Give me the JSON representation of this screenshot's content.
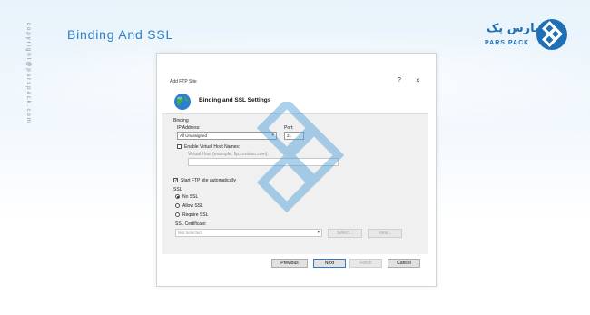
{
  "page": {
    "title": "Binding And SSL",
    "side_text": "copyright@parspack.com"
  },
  "logo": {
    "persian": "پارس پک",
    "english": "PARS PACK",
    "colors": {
      "primary": "#1f6fb6"
    },
    "icon": "parspack-logo-icon"
  },
  "dialog": {
    "window_title": "Add FTP Site",
    "help": "?",
    "close": "×",
    "heading": "Binding and SSL Settings",
    "icon": "globe-icon",
    "binding": {
      "label": "Binding",
      "ip_label": "IP Address:",
      "ip_value": "All Unassigned",
      "port_label": "Port:",
      "port_value": "21",
      "virtual_host_checkbox_label": "Enable Virtual Host Names:",
      "virtual_host_checked": false,
      "virtual_host_label": "Virtual Host (example: ftp.contoso.com):",
      "virtual_host_value": ""
    },
    "start_automatically_label": "Start FTP site automatically",
    "start_automatically_checked": true,
    "ssl": {
      "label": "SSL",
      "options": [
        "No SSL",
        "Allow SSL",
        "Require SSL"
      ],
      "selected": "No SSL",
      "certificate_label": "SSL Certificate:",
      "certificate_value": "Not Selected",
      "select_button": "Select...",
      "view_button": "View..."
    },
    "buttons": {
      "previous": "Previous",
      "next": "Next",
      "finish": "Finish",
      "cancel": "Cancel"
    }
  }
}
